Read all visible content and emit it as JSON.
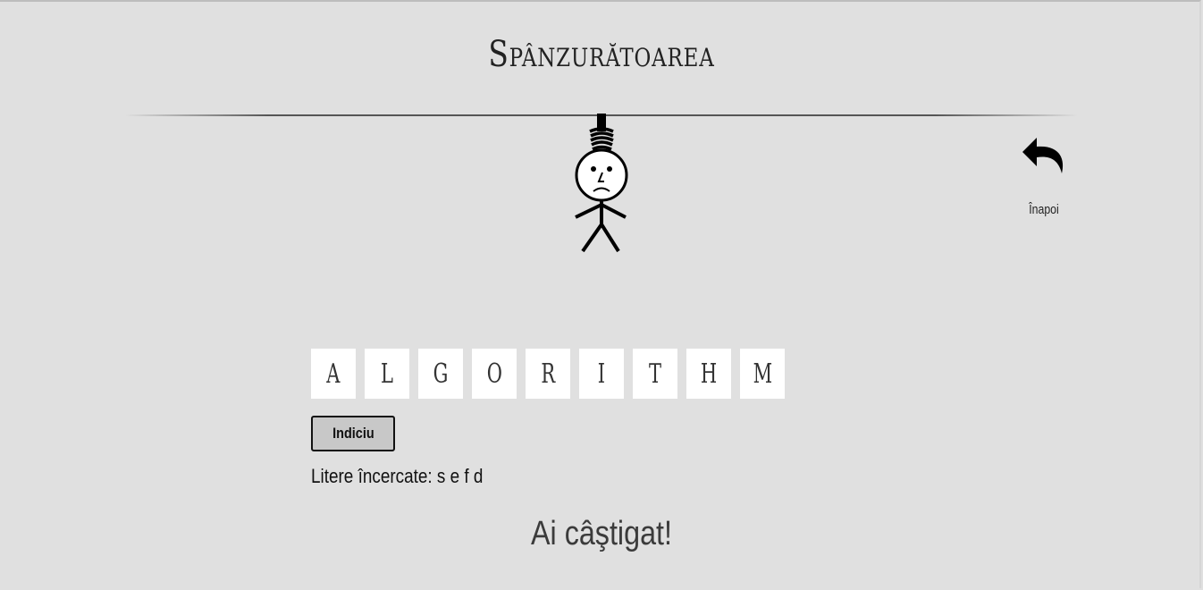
{
  "app": {
    "title": "Spânzurătoarea"
  },
  "navigation": {
    "back_label": "Înapoi",
    "back_icon": "undo-arrow-icon"
  },
  "hangman": {
    "state_icon": "hangman-figure",
    "face": "sad"
  },
  "word": {
    "letters": [
      "A",
      "L",
      "G",
      "O",
      "R",
      "I",
      "T",
      "H",
      "M"
    ]
  },
  "hint": {
    "button_label": "Indiciu"
  },
  "tried_letters": {
    "label": "Litere încercate:",
    "letters": [
      "s",
      "e",
      "f",
      "d"
    ],
    "text": "Litere încercate: s e f d"
  },
  "status": {
    "message": "Ai câştigat!"
  },
  "colors": {
    "background": "#e0e0e0",
    "tile": "#ffffff",
    "button": "#c8c8c8",
    "text": "#222222"
  }
}
